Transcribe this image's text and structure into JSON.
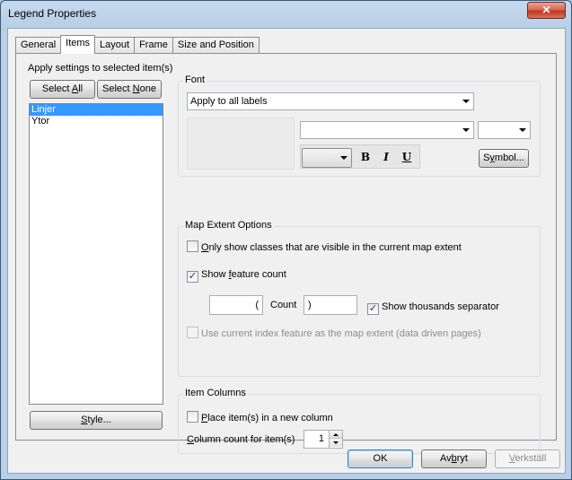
{
  "window": {
    "title": "Legend Properties",
    "close_glyph": "✕"
  },
  "tabs": [
    {
      "label": "General"
    },
    {
      "label": "Items",
      "active": true
    },
    {
      "label": "Layout"
    },
    {
      "label": "Frame"
    },
    {
      "label": "Size and Position"
    }
  ],
  "left": {
    "apply_label": "Apply settings to selected item(s)",
    "select_all": {
      "pre": "Select ",
      "key": "A",
      "post": "ll"
    },
    "select_none": {
      "pre": "Select ",
      "key": "N",
      "post": "one"
    },
    "items": [
      {
        "label": "Linjer",
        "selected": true
      },
      {
        "label": "Ytor",
        "selected": false
      }
    ],
    "style_button": {
      "key": "S",
      "post": "tyle..."
    }
  },
  "font": {
    "group_label": "Font",
    "apply_combo": "Apply to all labels",
    "font_combo": "",
    "size_combo": "",
    "color_combo": "",
    "bold": "B",
    "italic": "I",
    "underline": "U",
    "symbol_button": {
      "pre": "S",
      "key": "y",
      "post": "mbol..."
    }
  },
  "map_extent": {
    "group_label": "Map Extent Options",
    "only_visible": {
      "key": "O",
      "post": "nly show classes that are visible in the current map extent",
      "checked": false
    },
    "show_feature_count": {
      "pre": "Show ",
      "key": "f",
      "post": "eature count",
      "checked": true
    },
    "prefix_value": "(",
    "count_label": "Count",
    "suffix_value": ")",
    "thousands_sep": {
      "label": "Show thousands separator",
      "checked": true
    },
    "index_feature": {
      "label": "Use current index feature as the map extent (data driven pages)",
      "checked": false,
      "disabled": true
    }
  },
  "item_columns": {
    "group_label": "Item Columns",
    "new_column": {
      "key": "P",
      "post": "lace item(s) in a new column",
      "checked": false
    },
    "column_count": {
      "key": "C",
      "post": "olumn count for item(s)",
      "value": "1"
    }
  },
  "footer": {
    "ok": "OK",
    "cancel": {
      "pre": "Av",
      "key": "b",
      "post": "ryt"
    },
    "apply": {
      "key": "V",
      "post": "erkställ"
    }
  },
  "check_glyph": "✓"
}
